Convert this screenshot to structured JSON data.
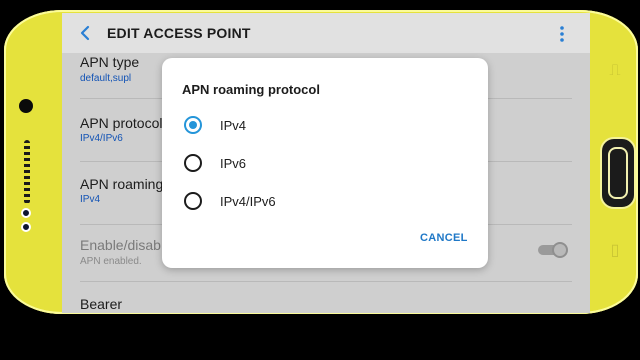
{
  "appbar": {
    "title": "EDIT ACCESS POINT",
    "back_icon": "back-arrow-icon",
    "more_icon": "more-vert-icon"
  },
  "settings": [
    {
      "title": "APN type",
      "value": "default,supl"
    },
    {
      "title": "APN protocol",
      "value": "IPv4/IPv6"
    },
    {
      "title": "APN roaming",
      "value": "IPv4"
    },
    {
      "title": "Enable/disab",
      "value": "APN enabled.",
      "enabled": false,
      "toggle_on": true
    },
    {
      "title": "Bearer",
      "value": ""
    }
  ],
  "dialog": {
    "title": "APN roaming protocol",
    "options": [
      {
        "label": "IPv4",
        "selected": true
      },
      {
        "label": "IPv6",
        "selected": false
      },
      {
        "label": "IPv4/IPv6",
        "selected": false
      }
    ],
    "cancel_label": "CANCEL"
  },
  "colors": {
    "accent": "#2495d9",
    "link": "#1253b5",
    "phone_body": "#e5e23c"
  }
}
